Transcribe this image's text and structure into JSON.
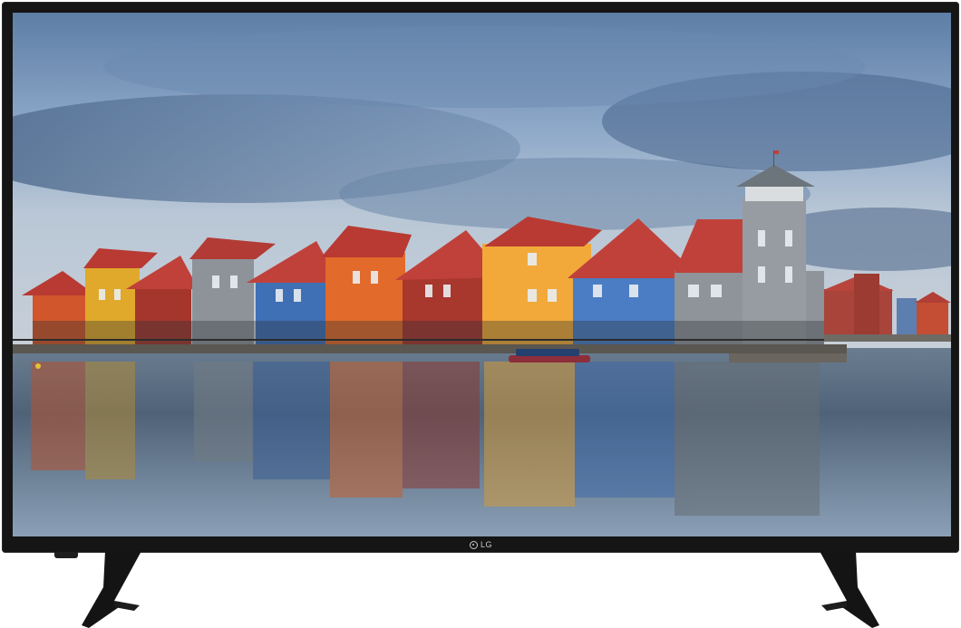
{
  "tv": {
    "brand_logo_text": "LG",
    "colors": {
      "bezel": "#151515",
      "stand": "#141414",
      "sky_top": "#5f7fa6",
      "water": "#3d4f63"
    },
    "icons": {
      "logo": "lg-logo-icon"
    }
  },
  "scene": {
    "houses": [
      {
        "color": "#d2562b"
      },
      {
        "color": "#e0a92b"
      },
      {
        "color": "#a5362d"
      },
      {
        "color": "#8d9399"
      },
      {
        "color": "#3f6fb5"
      },
      {
        "color": "#e26a2a"
      },
      {
        "color": "#a8372e"
      },
      {
        "color": "#f2a93a"
      },
      {
        "color": "#4a7dc4"
      },
      {
        "color": "#8e949a"
      }
    ]
  }
}
